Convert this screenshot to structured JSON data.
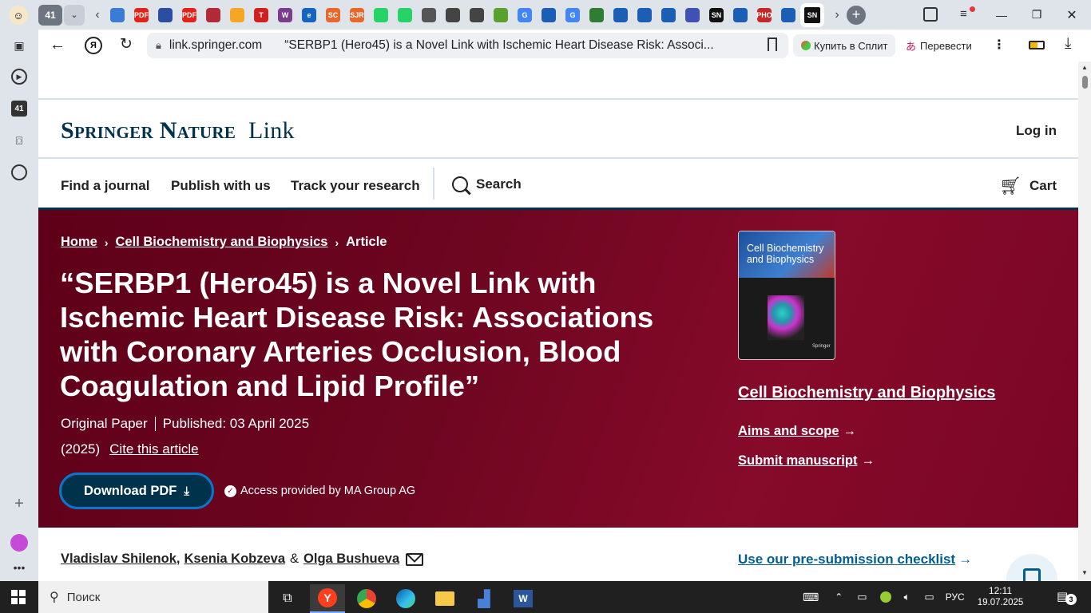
{
  "tabstrip": {
    "tab_count": "41",
    "favicons": [
      {
        "label": "",
        "color": "#3a7bd5"
      },
      {
        "label": "PDF",
        "color": "#e2231a"
      },
      {
        "label": "",
        "color": "#2b4ea2"
      },
      {
        "label": "PDF",
        "color": "#e2231a"
      },
      {
        "label": "",
        "color": "#b02a37"
      },
      {
        "label": "",
        "color": "#f5a623"
      },
      {
        "label": "T",
        "color": "#d02020"
      },
      {
        "label": "W",
        "color": "#7a3d8c"
      },
      {
        "label": "e",
        "color": "#1565c0"
      },
      {
        "label": "SC",
        "color": "#e8672b"
      },
      {
        "label": "SJR",
        "color": "#e8672b"
      },
      {
        "label": "",
        "color": "#25d366"
      },
      {
        "label": "",
        "color": "#25d366"
      },
      {
        "label": "",
        "color": "#555555"
      },
      {
        "label": "",
        "color": "#444444"
      },
      {
        "label": "",
        "color": "#444444"
      },
      {
        "label": "",
        "color": "#5aa02c"
      },
      {
        "label": "G",
        "color": "#4285f4"
      },
      {
        "label": "",
        "color": "#1a5fb4"
      },
      {
        "label": "G",
        "color": "#4285f4"
      },
      {
        "label": "",
        "color": "#2e7d32"
      },
      {
        "label": "",
        "color": "#1a5fb4"
      },
      {
        "label": "",
        "color": "#1a5fb4"
      },
      {
        "label": "",
        "color": "#1a5fb4"
      },
      {
        "label": "",
        "color": "#3f51b5"
      },
      {
        "label": "SN",
        "color": "#111111"
      },
      {
        "label": "",
        "color": "#1a5fb4"
      },
      {
        "label": "PHO",
        "color": "#c62828"
      },
      {
        "label": "",
        "color": "#1a5fb4"
      }
    ],
    "active_tab_label": "SN"
  },
  "toolbar": {
    "url_domain": "link.springer.com",
    "page_title": "“SERBP1 (Hero45) is a Novel Link with Ischemic Heart Disease Risk: Associ...",
    "ext_split": "Купить в Сплит",
    "ext_translate": "Перевести"
  },
  "site": {
    "logo_bold": "Springer Nature",
    "logo_light": "Link",
    "login": "Log in",
    "nav": [
      "Find a journal",
      "Publish with us",
      "Track your research"
    ],
    "search": "Search",
    "cart": "Cart"
  },
  "article": {
    "breadcrumb": {
      "home": "Home",
      "journal": "Cell Biochemistry and Biophysics",
      "current": "Article"
    },
    "title": "“SERBP1 (Hero45) is a Novel Link with Ischemic Heart Disease Risk: Associations with Coronary Arteries Occlusion, Blood Coagulation and Lipid Profile”",
    "type": "Original Paper",
    "published": "Published: 03 April 2025",
    "year": "(2025)",
    "cite": "Cite this article",
    "download": "Download PDF",
    "access": "Access provided by MA Group AG",
    "authors": [
      "Vladislav Shilenok",
      "Ksenia Kobzeva",
      "Olga Bushueva"
    ],
    "author_sep_comma": ",",
    "author_sep_amp": "&"
  },
  "journal": {
    "cover_title": "Cell Biochemistry and Biophysics",
    "cover_publisher": "Springer",
    "name": "Cell Biochemistry and Biophysics",
    "aims": "Aims and scope",
    "submit": "Submit manuscript",
    "checklist": "Use our pre-submission checklist"
  },
  "taskbar": {
    "search_placeholder": "Поиск",
    "lang": "РУС",
    "time": "12:11",
    "date": "19.07.2025",
    "notif_count": "3"
  }
}
